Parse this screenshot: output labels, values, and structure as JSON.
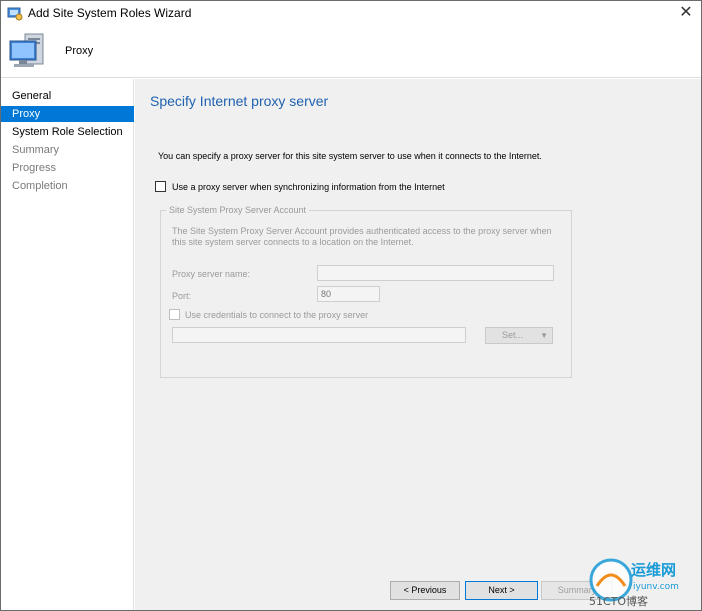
{
  "window": {
    "title": "Add Site System Roles Wizard",
    "close_glyph": "✕"
  },
  "header": {
    "title": "Proxy",
    "icon": "computer-monitor-icon"
  },
  "sidebar": {
    "items": [
      {
        "label": "General",
        "state": "normal"
      },
      {
        "label": "Proxy",
        "state": "active"
      },
      {
        "label": "System Role Selection",
        "state": "normal"
      },
      {
        "label": "Summary",
        "state": "disabled"
      },
      {
        "label": "Progress",
        "state": "disabled"
      },
      {
        "label": "Completion",
        "state": "disabled"
      }
    ]
  },
  "main": {
    "heading": "Specify Internet proxy server",
    "intro": "You can specify a proxy server for this site system server to use when it connects to the Internet.",
    "use_proxy_label": "Use a proxy server when synchronizing information from the Internet",
    "group": {
      "title": "Site System Proxy Server Account",
      "description_line1": "The Site System Proxy Server Account provides authenticated access to the proxy server when",
      "description_line2": "this site system server connects to a location on the Internet.",
      "server_name_label": "Proxy server name:",
      "server_name_value": "",
      "port_label": "Port:",
      "port_value": "80",
      "use_credentials_label": "Use credentials to connect to the proxy server",
      "account_value": "",
      "set_button": "Set..."
    }
  },
  "footer": {
    "previous": "< Previous",
    "next": "Next >",
    "summary": "Summary"
  },
  "watermark": {
    "line1": "运维网",
    "line2": "iyunv.com",
    "line3": "51CTO博客"
  },
  "colors": {
    "accent": "#0078d7",
    "heading": "#1f62b0"
  }
}
